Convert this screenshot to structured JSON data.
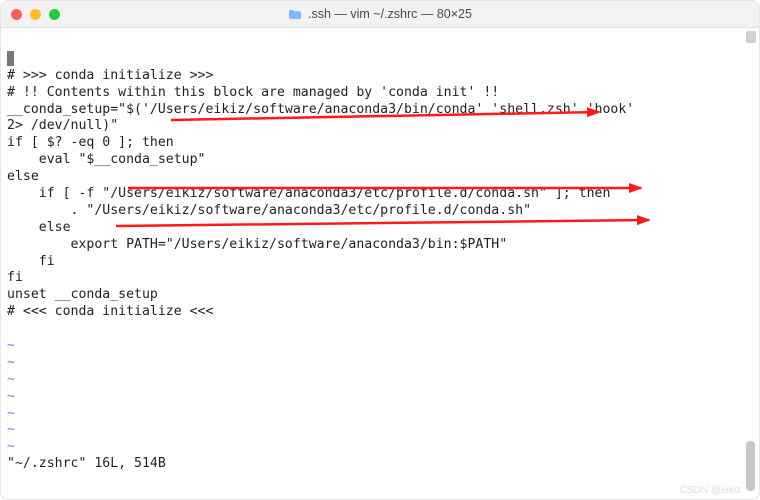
{
  "titlebar": {
    "title": ".ssh — vim ~/.zshrc — 80×25",
    "folder_icon": "folder-icon"
  },
  "traffic_lights": {
    "close": "close",
    "minimize": "minimize",
    "maximize": "maximize"
  },
  "editor": {
    "lines": [
      "",
      "# >>> conda initialize >>>",
      "# !! Contents within this block are managed by 'conda init' !!",
      "__conda_setup=\"$('/Users/eikiz/software/anaconda3/bin/conda' 'shell.zsh' 'hook'",
      "2> /dev/null)\"",
      "if [ $? -eq 0 ]; then",
      "    eval \"$__conda_setup\"",
      "else",
      "    if [ -f \"/Users/eikiz/software/anaconda3/etc/profile.d/conda.sh\" ]; then",
      "        . \"/Users/eikiz/software/anaconda3/etc/profile.d/conda.sh\"",
      "    else",
      "        export PATH=\"/Users/eikiz/software/anaconda3/bin:$PATH\"",
      "    fi",
      "fi",
      "unset __conda_setup",
      "# <<< conda initialize <<<"
    ],
    "tilde_count": 7,
    "tilde_char": "~",
    "status": "\"~/.zshrc\" 16L, 514B"
  },
  "annotations": {
    "arrow_color": "#ff1a1a"
  },
  "watermark": "CSDN @eikiz"
}
